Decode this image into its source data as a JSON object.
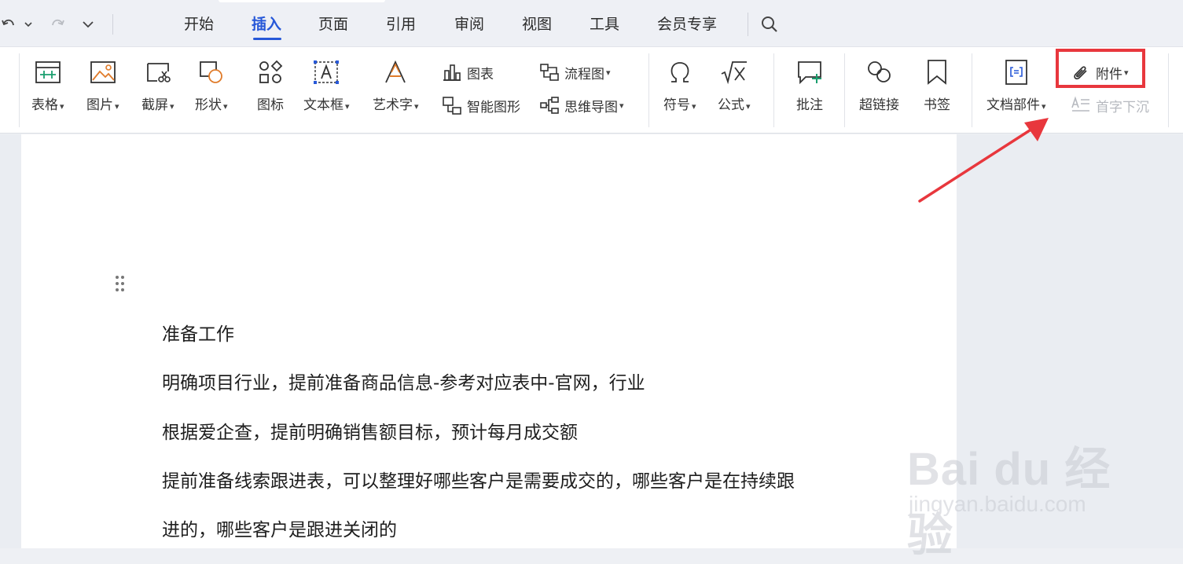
{
  "tabs": [
    {
      "label": "开始"
    },
    {
      "label": "插入",
      "active": true
    },
    {
      "label": "页面"
    },
    {
      "label": "引用"
    },
    {
      "label": "审阅"
    },
    {
      "label": "视图"
    },
    {
      "label": "工具"
    },
    {
      "label": "会员专享"
    }
  ],
  "ribbon": {
    "table": "表格",
    "picture": "图片",
    "screenshot": "截屏",
    "shape": "形状",
    "icon": "图标",
    "textbox": "文本框",
    "wordart": "艺术字",
    "chart": "图表",
    "smartart": "智能图形",
    "flowchart": "流程图",
    "mindmap": "思维导图",
    "symbol": "符号",
    "formula": "公式",
    "comment": "批注",
    "hyperlink": "超链接",
    "bookmark": "书签",
    "docparts": "文档部件",
    "attachment": "附件",
    "dropcap": "首字下沉"
  },
  "document": {
    "paragraphs": [
      "准备工作",
      "明确项目行业，提前准备商品信息-参考对应表中-官网，行业",
      "根据爱企查，提前明确销售额目标，预计每月成交额",
      "提前准备线索跟进表，可以整理好哪些客户是需要成交的，哪些客户是在持续跟",
      "进的，哪些客户是跟进关闭的"
    ]
  },
  "watermark": {
    "brand": "Bai du 经验",
    "url": "jingyan.baidu.com"
  },
  "colors": {
    "accent": "#2758d8",
    "highlight": "#e8373d",
    "disabled": "#b6b9bf"
  },
  "icons": [
    "undo-icon",
    "redo-icon",
    "chevron-down-icon",
    "search-icon",
    "paperclip-icon"
  ]
}
